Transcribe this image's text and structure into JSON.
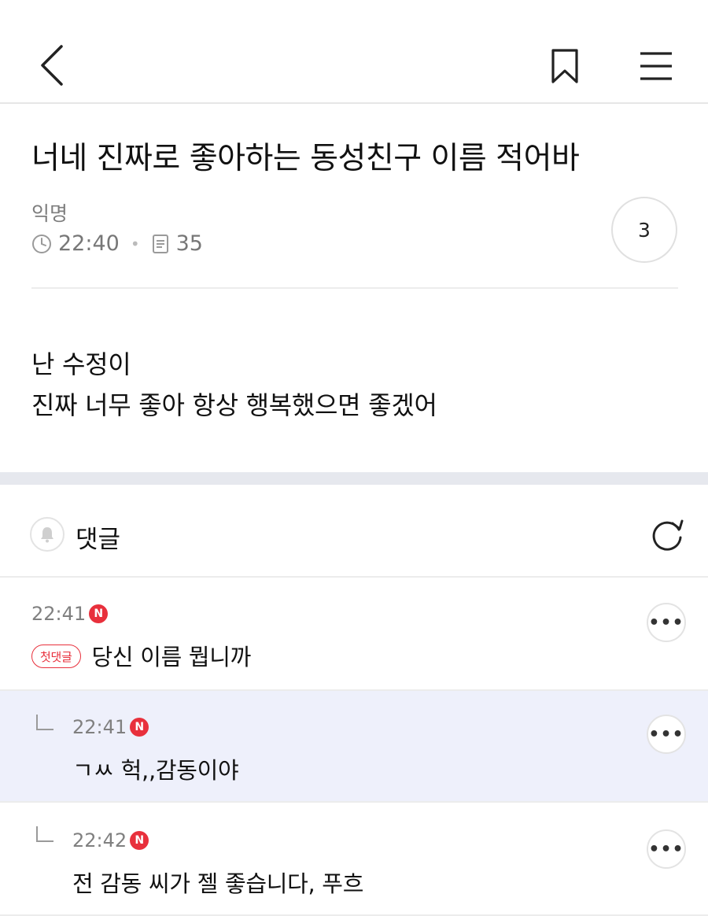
{
  "header": {
    "back_icon": "chevron-left-icon",
    "bookmark_icon": "bookmark-icon",
    "menu_icon": "hamburger-menu-icon"
  },
  "post": {
    "title": "너네 진짜로 좋아하는 동성친구 이름 적어바",
    "author": "익명",
    "time": "22:40",
    "views": "35",
    "comment_count": "3",
    "body_lines": [
      "난 수정이",
      "진짜 너무 좋아 항상 행복했으면 좋겠어"
    ]
  },
  "comments_section": {
    "label": "댓글",
    "bell_icon": "bell-icon",
    "refresh_icon": "refresh-icon"
  },
  "comments": [
    {
      "time": "22:41",
      "new_badge": "N",
      "first_tag": "첫댓글",
      "text": "당신 이름 뭡니까",
      "is_reply": false,
      "more": "•••"
    },
    {
      "time": "22:41",
      "new_badge": "N",
      "text": "ㄱㅆ 헉,,감동이야",
      "is_reply": true,
      "more": "•••"
    },
    {
      "time": "22:42",
      "new_badge": "N",
      "text": "전 감동 씨가 젤 좋습니다, 푸흐",
      "is_reply": true,
      "more": "•••"
    }
  ],
  "colors": {
    "accent_red": "#e8303c",
    "highlight_bg": "#eef0fb",
    "section_gap": "#e6e8ee"
  }
}
